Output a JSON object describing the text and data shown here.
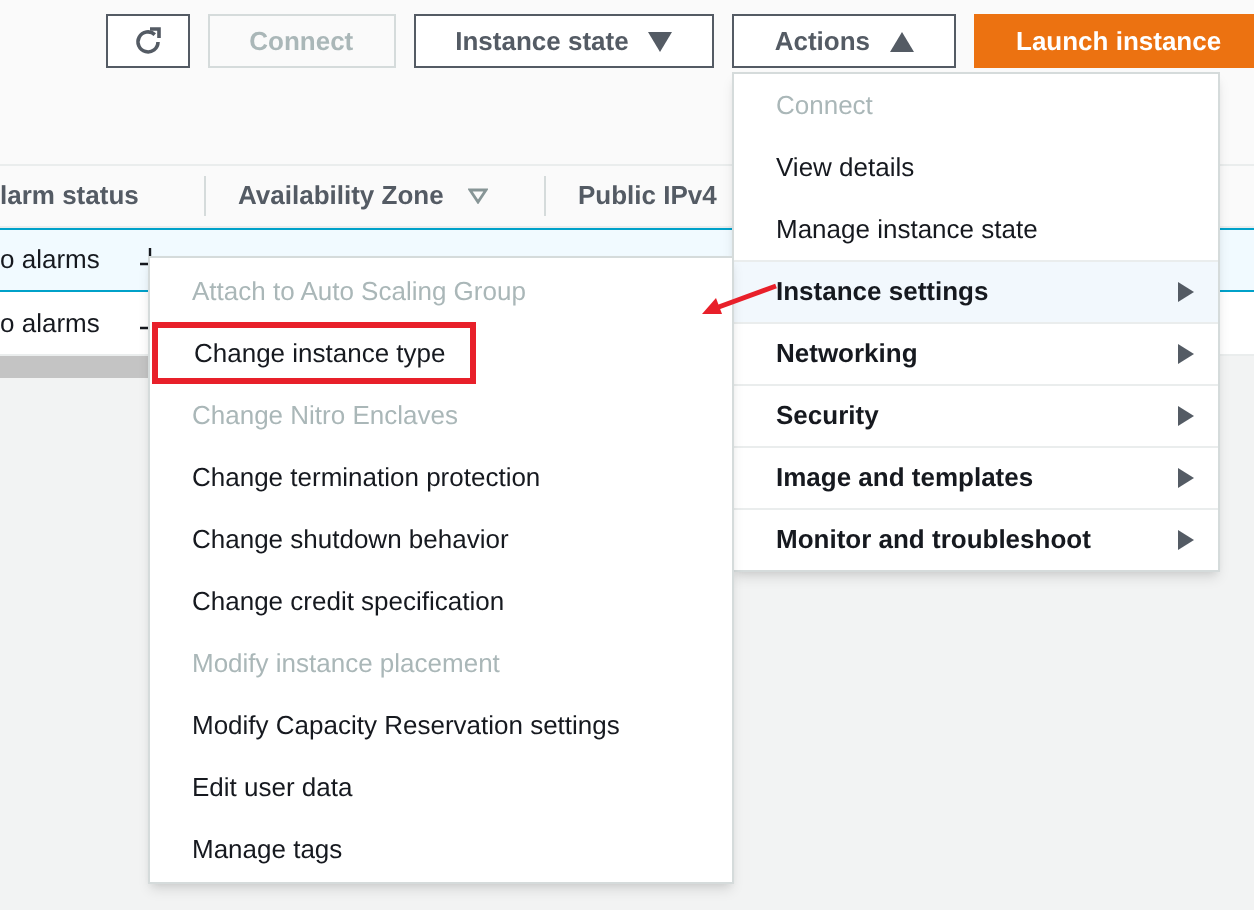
{
  "toolbar": {
    "buttons": [
      {
        "kind": "refresh"
      },
      {
        "kind": "plain",
        "label": "Connect",
        "disabled": true
      },
      {
        "kind": "dropdown",
        "label": "Instance state",
        "expanded": false
      },
      {
        "kind": "dropdown",
        "label": "Actions",
        "expanded": true
      },
      {
        "kind": "primary",
        "label": "Launch instance"
      }
    ]
  },
  "table": {
    "columns": [
      {
        "label": "larm status"
      },
      {
        "label": "Availability Zone",
        "filter": true
      },
      {
        "label": "Public IPv4"
      }
    ],
    "rows": [
      {
        "cells": [
          "o alarms"
        ],
        "selected": true
      },
      {
        "cells": [
          "o alarms"
        ],
        "selected": false
      }
    ]
  },
  "actions_menu": {
    "items": [
      {
        "label": "Connect",
        "disabled": true,
        "kind": "action"
      },
      {
        "label": "View details",
        "disabled": false,
        "kind": "action"
      },
      {
        "label": "Manage instance state",
        "disabled": false,
        "kind": "action"
      },
      {
        "label": "Instance settings",
        "disabled": false,
        "kind": "submenu",
        "expanded": true
      },
      {
        "label": "Networking",
        "disabled": false,
        "kind": "submenu",
        "expanded": false
      },
      {
        "label": "Security",
        "disabled": false,
        "kind": "submenu",
        "expanded": false
      },
      {
        "label": "Image and templates",
        "disabled": false,
        "kind": "submenu",
        "expanded": false
      },
      {
        "label": "Monitor and troubleshoot",
        "disabled": false,
        "kind": "submenu",
        "expanded": false
      }
    ]
  },
  "submenu": {
    "items": [
      {
        "label": "Attach to Auto Scaling Group",
        "disabled": true,
        "highlighted": false
      },
      {
        "label": "Change instance type",
        "disabled": false,
        "highlighted": true
      },
      {
        "label": "Change Nitro Enclaves",
        "disabled": true,
        "highlighted": false
      },
      {
        "label": "Change termination protection",
        "disabled": false,
        "highlighted": false
      },
      {
        "label": "Change shutdown behavior",
        "disabled": false,
        "highlighted": false
      },
      {
        "label": "Change credit specification",
        "disabled": false,
        "highlighted": false
      },
      {
        "label": "Modify instance placement",
        "disabled": true,
        "highlighted": false
      },
      {
        "label": "Modify Capacity Reservation settings",
        "disabled": false,
        "highlighted": false
      },
      {
        "label": "Edit user data",
        "disabled": false,
        "highlighted": false
      },
      {
        "label": "Manage tags",
        "disabled": false,
        "highlighted": false
      }
    ]
  }
}
